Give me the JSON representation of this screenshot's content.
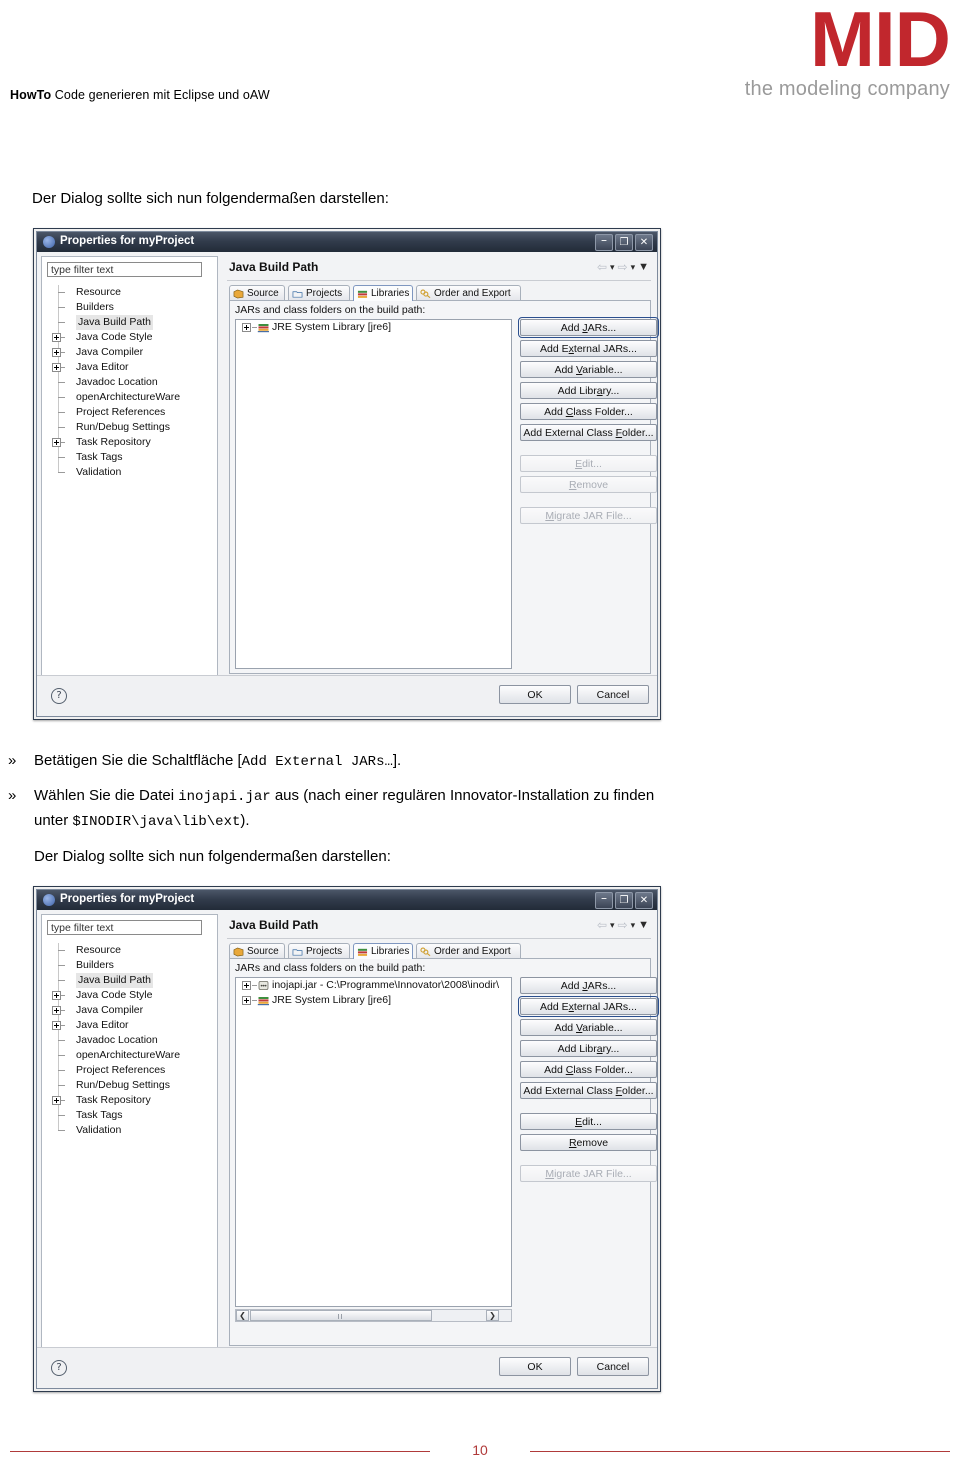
{
  "header": {
    "doc_title_bold": "HowTo",
    "doc_title_rest": " Code generieren mit Eclipse und oAW",
    "logo_main": "MID",
    "logo_tagline": "the modeling company",
    "brand_color": "#c1272d",
    "tagline_color": "#9a9a9a"
  },
  "intro": {
    "line1": "Der Dialog sollte sich nun folgendermaßen darstellen:"
  },
  "steps": {
    "bullet_glyph": "»",
    "step1": {
      "text_before": "Betätigen Sie die Schaltfläche [",
      "code": "Add External JARs…",
      "text_after": "]."
    },
    "step2": {
      "text_before": "Wählen Sie die Datei ",
      "code1": "inojapi.jar",
      "text_mid": " aus (nach einer regulären Innovator-Installation zu finden",
      "text_line2_before": "unter ",
      "code2": "$INODIR\\java\\lib\\ext",
      "text_after": ")."
    },
    "closing": "Der Dialog sollte sich nun folgendermaßen darstellen:"
  },
  "dialog": {
    "title": "Properties for myProject",
    "window_buttons": {
      "minimize": "–",
      "maximize": "❐",
      "close": "✕"
    },
    "filter_placeholder": "type filter text",
    "tree_items": [
      {
        "label": "Resource",
        "expandable": false,
        "selected": false
      },
      {
        "label": "Builders",
        "expandable": false,
        "selected": false
      },
      {
        "label": "Java Build Path",
        "expandable": false,
        "selected": true
      },
      {
        "label": "Java Code Style",
        "expandable": true,
        "selected": false
      },
      {
        "label": "Java Compiler",
        "expandable": true,
        "selected": false
      },
      {
        "label": "Java Editor",
        "expandable": true,
        "selected": false
      },
      {
        "label": "Javadoc Location",
        "expandable": false,
        "selected": false
      },
      {
        "label": "openArchitectureWare",
        "expandable": false,
        "selected": false
      },
      {
        "label": "Project References",
        "expandable": false,
        "selected": false
      },
      {
        "label": "Run/Debug Settings",
        "expandable": false,
        "selected": false
      },
      {
        "label": "Task Repository",
        "expandable": true,
        "selected": false
      },
      {
        "label": "Task Tags",
        "expandable": false,
        "selected": false
      },
      {
        "label": "Validation",
        "expandable": false,
        "selected": false
      }
    ],
    "page_title": "Java Build Path",
    "nav": {
      "back": "⇦",
      "forward": "⇨",
      "menu": "▼"
    },
    "tabs": [
      {
        "label": "Source",
        "active": false
      },
      {
        "label": "Projects",
        "active": false
      },
      {
        "label": "Libraries",
        "active": true
      },
      {
        "label": "Order and Export",
        "active": false
      }
    ],
    "panel_label": "JARs and class folders on the build path:",
    "buttons_a": [
      {
        "label": "Add JARs...",
        "mnemonic": "J",
        "state": "normal"
      },
      {
        "label": "Add External JARs...",
        "mnemonic": "x",
        "state": "normal"
      },
      {
        "label": "Add Variable...",
        "mnemonic": "V",
        "state": "normal"
      },
      {
        "label": "Add Library...",
        "mnemonic": "a",
        "state": "normal"
      },
      {
        "label": "Add Class Folder...",
        "mnemonic": "C",
        "state": "normal"
      },
      {
        "label": "Add External Class Folder...",
        "mnemonic": "F",
        "state": "normal"
      },
      {
        "label": "Edit...",
        "mnemonic": "E",
        "state": "disabled"
      },
      {
        "label": "Remove",
        "mnemonic": "R",
        "state": "disabled"
      },
      {
        "label": "Migrate JAR File...",
        "mnemonic": "M",
        "state": "disabled"
      }
    ],
    "ok_label": "OK",
    "cancel_label": "Cancel",
    "help_glyph": "?"
  },
  "dialog1": {
    "focused_button": "Add JARs...",
    "list_rows": [
      {
        "label": "JRE System Library [jre6]",
        "icon": "jre-library-icon"
      }
    ],
    "scrollbar_visible": false
  },
  "dialog2": {
    "focused_button": "Add External JARs...",
    "list_rows": [
      {
        "label": "inojapi.jar - C:\\Programme\\Innovator\\2008\\inodir\\",
        "icon": "jar-icon"
      },
      {
        "label": "JRE System Library [jre6]",
        "icon": "jre-library-icon"
      }
    ],
    "buttons_b": [
      {
        "label": "Add JARs...",
        "mnemonic": "J",
        "state": "normal"
      },
      {
        "label": "Add External JARs...",
        "mnemonic": "x",
        "state": "focused"
      },
      {
        "label": "Add Variable...",
        "mnemonic": "V",
        "state": "normal"
      },
      {
        "label": "Add Library...",
        "mnemonic": "a",
        "state": "normal"
      },
      {
        "label": "Add Class Folder...",
        "mnemonic": "C",
        "state": "normal"
      },
      {
        "label": "Add External Class Folder...",
        "mnemonic": "F",
        "state": "normal"
      },
      {
        "label": "Edit...",
        "mnemonic": "E",
        "state": "normal"
      },
      {
        "label": "Remove",
        "mnemonic": "R",
        "state": "normal"
      },
      {
        "label": "Migrate JAR File...",
        "mnemonic": "M",
        "state": "disabled"
      }
    ],
    "scrollbar_visible": true,
    "scroll_left_glyph": "❮",
    "scroll_right_glyph": "❯"
  },
  "footer": {
    "page_number": "10",
    "rule_color": "#b03a3a"
  }
}
